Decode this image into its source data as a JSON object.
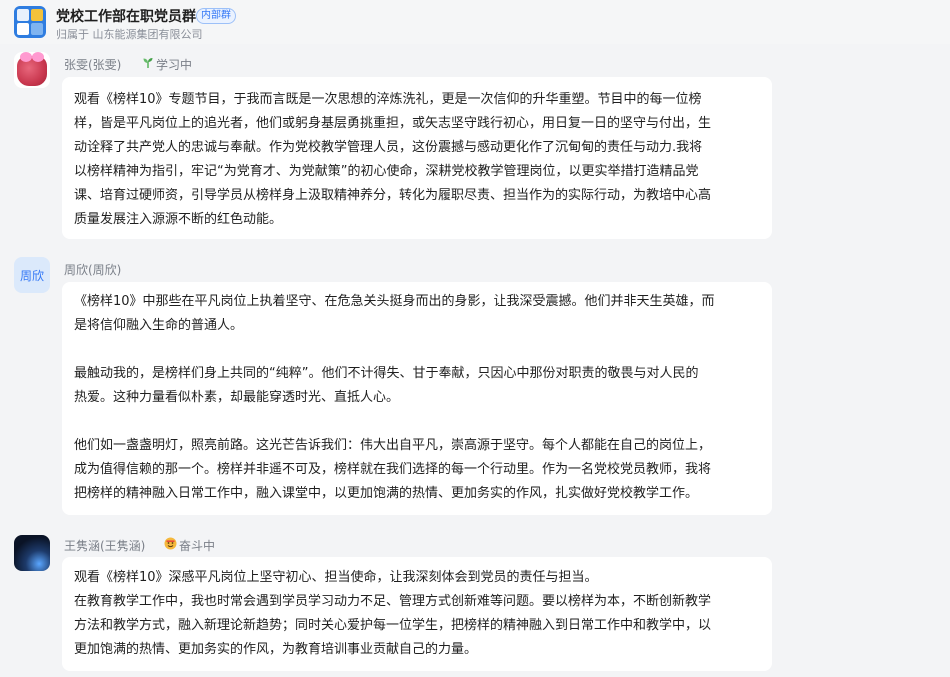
{
  "header": {
    "group_name": "党校工作部在职党员群",
    "badge": "内部群",
    "org": "归属于 山东能源集团有限公司"
  },
  "messages": [
    {
      "sender": "张雯(张雯)",
      "status_icon": "seedling-icon",
      "status": "学习中",
      "lines": [
        "观看《榜样10》专题节目，于我而言既是一次思想的淬炼洗礼，更是一次信仰的升华重塑。节目中的每一位榜",
        "样，皆是平凡岗位上的追光者，他们或躬身基层勇挑重担，或矢志坚守践行初心，用日复一日的坚守与付出，生",
        "动诠释了共产党人的忠诚与奉献。作为党校教学管理人员，这份震撼与感动更化作了沉甸甸的责任与动力.我将",
        "以榜样精神为指引，牢记“为党育才、为党献策”的初心使命，深耕党校教学管理岗位，以更实举措打造精品党",
        "课、培育过硬师资，引导学员从榜样身上汲取精神养分，转化为履职尽责、担当作为的实际行动，为教培中心高",
        "质量发展注入源源不断的红色动能。"
      ]
    },
    {
      "sender": "周欣(周欣)",
      "avatar_text": "周欣",
      "p1": [
        "《榜样10》中那些在平凡岗位上执着坚守、在危急关头挺身而出的身影，让我深受震撼。他们并非天生英雄，而",
        "是将信仰融入生命的普通人。"
      ],
      "p2": [
        "最触动我的，是榜样们身上共同的“纯粹”。他们不计得失、甘于奉献，只因心中那份对职责的敬畏与对人民的",
        "热爱。这种力量看似朴素，却最能穿透时光、直抵人心。"
      ],
      "p3": [
        "他们如一盏盏明灯，照亮前路。这光芒告诉我们：伟大出自平凡，崇高源于坚守。每个人都能在自己的岗位上，",
        "成为值得信赖的那一个。榜样并非遥不可及，榜样就在我们选择的每一个行动里。作为一名党校党员教师，我将",
        "把榜样的精神融入日常工作中，融入课堂中，以更加饱满的热情、更加务实的作风，扎实做好党校教学工作。"
      ]
    },
    {
      "sender": "王隽涵(王隽涵)",
      "status_icon": "grin-icon",
      "status": "奋斗中",
      "lines": [
        "观看《榜样10》深感平凡岗位上坚守初心、担当使命，让我深刻体会到党员的责任与担当。",
        "在教育教学工作中，我也时常会遇到学员学习动力不足、管理方式创新难等问题。要以榜样为本，不断创新教学",
        "方法和教学方式，融入新理论新趋势；同时关心爱护每一位学生，把榜样的精神融入到日常工作中和教学中，以",
        "更加饱满的热情、更加务实的作风，为教育培训事业贡献自己的力量。"
      ]
    }
  ]
}
